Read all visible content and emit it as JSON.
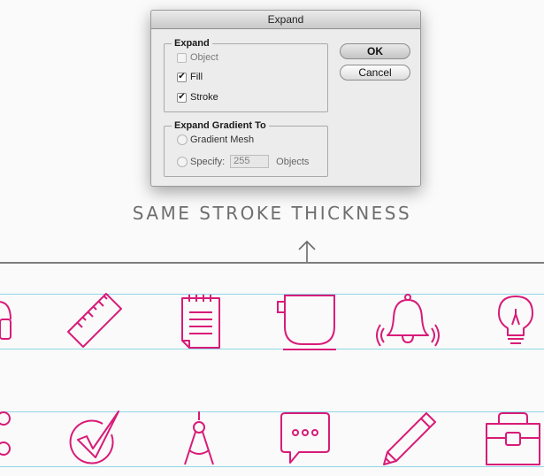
{
  "dialog": {
    "title": "Expand",
    "expand_group": {
      "legend": "Expand",
      "object_label": "Object",
      "fill_label": "Fill",
      "stroke_label": "Stroke",
      "object_checked": false,
      "fill_checked": true,
      "stroke_checked": true
    },
    "gradient_group": {
      "legend": "Expand Gradient To",
      "gradient_mesh_label": "Gradient Mesh",
      "specify_label": "Specify:",
      "specify_value": "255",
      "objects_label": "Objects"
    },
    "ok_label": "OK",
    "cancel_label": "Cancel",
    "check_glyph": "✔"
  },
  "heading": "SAME STROKE THICKNESS",
  "colors": {
    "icon_stroke": "#d81b78",
    "guide_line": "#8fd6e6",
    "divider": "#7d7d7d",
    "heading_text": "#6e6e6e"
  },
  "icons_row1": [
    "headphones-icon",
    "ruler-icon",
    "notepad-icon",
    "cup-icon",
    "bell-icon",
    "lightbulb-icon"
  ],
  "icons_row2": [
    "circles-icon",
    "checkmark-icon",
    "compass-icon",
    "chat-bubble-icon",
    "pencil-icon",
    "briefcase-icon"
  ]
}
